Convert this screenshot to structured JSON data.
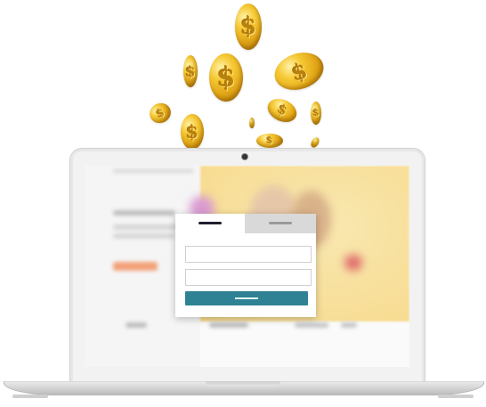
{
  "coins": {
    "symbol": "$",
    "color": "#e9b21d"
  },
  "login_form": {
    "tabs": [
      {
        "label": "",
        "active": true
      },
      {
        "label": "",
        "active": false
      }
    ],
    "fields": [
      {
        "placeholder": ""
      },
      {
        "placeholder": ""
      }
    ],
    "submit_label": "",
    "accent_color": "#2e8294"
  }
}
